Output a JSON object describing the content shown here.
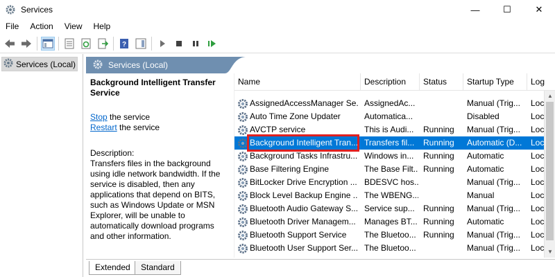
{
  "window": {
    "title": "Services",
    "minimize_glyph": "—",
    "maximize_glyph": "☐",
    "close_glyph": "✕"
  },
  "menu": [
    "File",
    "Action",
    "View",
    "Help"
  ],
  "toolbar_icons": [
    "back-icon",
    "forward-icon",
    "show-hide-console-tree-icon",
    "properties-icon",
    "refresh-icon",
    "export-list-icon",
    "help-icon",
    "show-hide-action-pane-icon",
    "start-service-icon",
    "stop-service-icon",
    "pause-service-icon",
    "restart-service-icon"
  ],
  "tree": {
    "root_label": "Services (Local)"
  },
  "header": {
    "label": "Services (Local)"
  },
  "detail": {
    "title": "Background Intelligent Transfer Service",
    "stop_link": "Stop",
    "stop_suffix": " the service",
    "restart_link": "Restart",
    "restart_suffix": " the service",
    "description_label": "Description:",
    "description": "Transfers files in the background using idle network bandwidth. If the service is disabled, then any applications that depend on BITS, such as Windows Update or MSN Explorer, will be unable to automatically download programs and other information."
  },
  "columns": [
    "Name",
    "Description",
    "Status",
    "Startup Type",
    "Log"
  ],
  "sort_indicator": "^",
  "rows": [
    {
      "name": "AssignedAccessManager Se...",
      "desc": "AssignedAc...",
      "status": "",
      "startup": "Manual (Trig...",
      "logon": "Loc"
    },
    {
      "name": "Auto Time Zone Updater",
      "desc": "Automatica...",
      "status": "",
      "startup": "Disabled",
      "logon": "Loc"
    },
    {
      "name": "AVCTP service",
      "desc": "This is Audi...",
      "status": "Running",
      "startup": "Manual (Trig...",
      "logon": "Loc"
    },
    {
      "name": "Background Intelligent Tran...",
      "desc": "Transfers fil...",
      "status": "Running",
      "startup": "Automatic (D...",
      "logon": "Loc"
    },
    {
      "name": "Background Tasks Infrastru...",
      "desc": "Windows in...",
      "status": "Running",
      "startup": "Automatic",
      "logon": "Loc"
    },
    {
      "name": "Base Filtering Engine",
      "desc": "The Base Filt...",
      "status": "Running",
      "startup": "Automatic",
      "logon": "Loc"
    },
    {
      "name": "BitLocker Drive Encryption ...",
      "desc": "BDESVC hos...",
      "status": "",
      "startup": "Manual (Trig...",
      "logon": "Loc"
    },
    {
      "name": "Block Level Backup Engine ...",
      "desc": "The WBENG...",
      "status": "",
      "startup": "Manual",
      "logon": "Loc"
    },
    {
      "name": "Bluetooth Audio Gateway S...",
      "desc": "Service sup...",
      "status": "Running",
      "startup": "Manual (Trig...",
      "logon": "Loc"
    },
    {
      "name": "Bluetooth Driver Managem...",
      "desc": "Manages BT...",
      "status": "Running",
      "startup": "Automatic",
      "logon": "Loc"
    },
    {
      "name": "Bluetooth Support Service",
      "desc": "The Bluetoo...",
      "status": "Running",
      "startup": "Manual (Trig...",
      "logon": "Loc"
    },
    {
      "name": "Bluetooth User Support Ser...",
      "desc": "The Bluetoo...",
      "status": "",
      "startup": "Manual (Trig...",
      "logon": "Loc"
    }
  ],
  "selected_row_index": 3,
  "tabs": [
    "Extended",
    "Standard"
  ],
  "colors": {
    "selection": "#0078d7",
    "header_strip": "#6f8fb0",
    "link": "#0066cc",
    "highlight_box": "#e02020"
  }
}
